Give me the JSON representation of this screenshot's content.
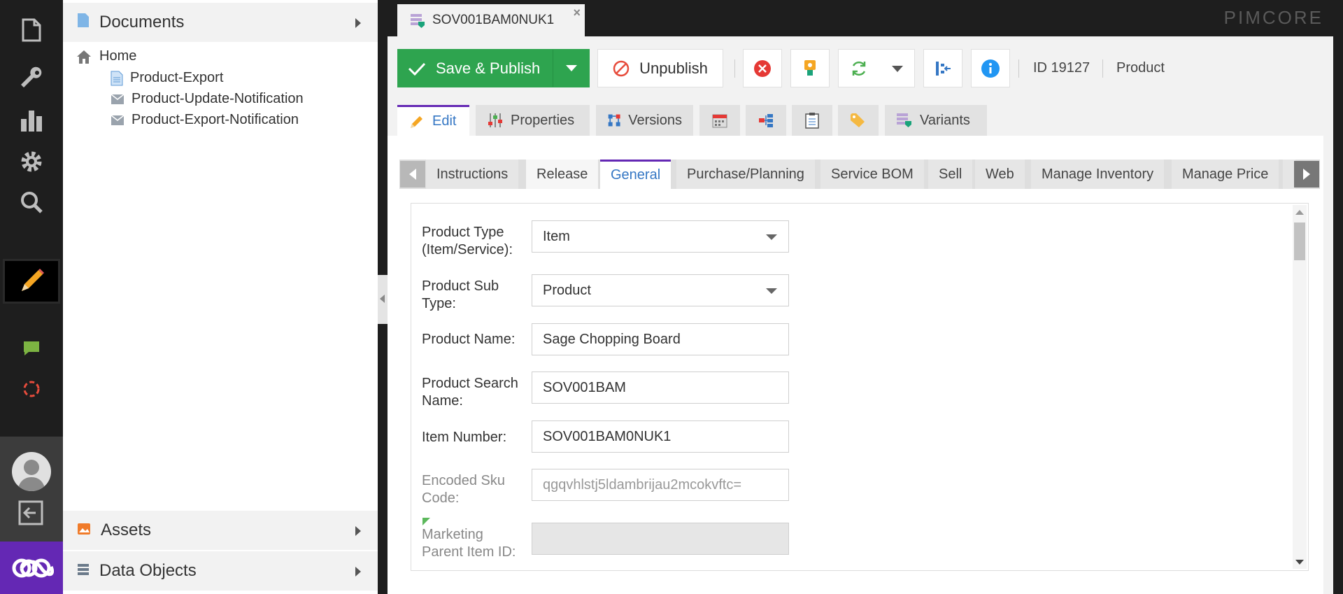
{
  "rail": {
    "icons": [
      "document-icon",
      "wrench-icon",
      "bar-chart-icon",
      "gear-icon",
      "search-icon",
      "pencil-icon",
      "chat-icon",
      "sync-icon",
      "avatar",
      "logout-icon",
      "pimcore-logo-icon"
    ]
  },
  "tree": {
    "documents_label": "Documents",
    "assets_label": "Assets",
    "data_objects_label": "Data Objects",
    "home_label": "Home",
    "items": [
      {
        "label": "Product-Export",
        "icon": "page-icon"
      },
      {
        "label": "Product-Update-Notification",
        "icon": "email-icon"
      },
      {
        "label": "Product-Export-Notification",
        "icon": "email-icon"
      }
    ]
  },
  "topbar": {
    "open_tab_label": "SOV001BAM0NUK1",
    "close_symbol": "×",
    "brand": "PIMCORE"
  },
  "toolbar": {
    "save_publish_label": "Save & Publish",
    "unpublish_label": "Unpublish",
    "id_text": "ID 19127",
    "class_text": "Product"
  },
  "editor_tabs": {
    "edit": "Edit",
    "properties": "Properties",
    "versions": "Versions",
    "variants": "Variants"
  },
  "subtabs": [
    "Instructions",
    "Release",
    "General",
    "Purchase/Planning",
    "Service BOM",
    "Sell",
    "Web",
    "Manage Inventory",
    "Manage Price"
  ],
  "form": {
    "product_type_label_1": "Product Type",
    "product_type_label_2": "(Item/Service):",
    "product_type_value": "Item",
    "product_sub_type_label_1": "Product Sub",
    "product_sub_type_label_2": "Type:",
    "product_sub_type_value": "Product",
    "product_name_label": "Product Name:",
    "product_name_value": "Sage Chopping Board",
    "search_name_label_1": "Product Search",
    "search_name_label_2": "Name:",
    "search_name_value": "SOV001BAM",
    "item_number_label": "Item Number:",
    "item_number_value": "SOV001BAM0NUK1",
    "encoded_sku_label_1": "Encoded Sku",
    "encoded_sku_label_2": "Code:",
    "encoded_sku_value": "qgqvhlstj5ldambrijau2mcokvftc=",
    "marketing_parent_label_1": "Marketing",
    "marketing_parent_label_2": "Parent Item ID:",
    "marketing_parent_value": ""
  },
  "colors": {
    "accent_purple": "#6428b4",
    "save_green": "#2ea44f",
    "link_blue": "#3577c4"
  }
}
